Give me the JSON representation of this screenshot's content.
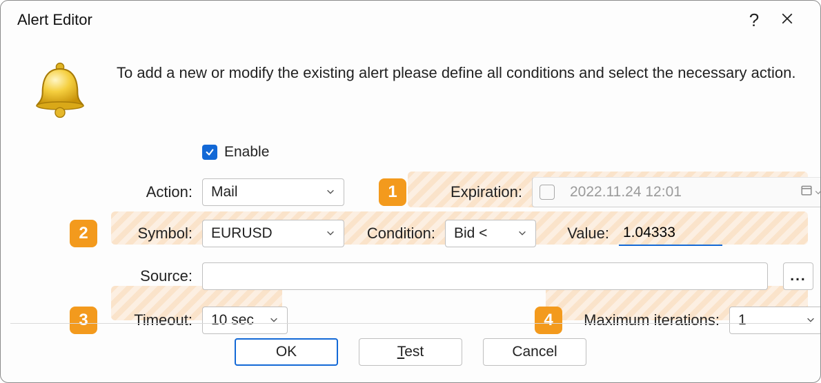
{
  "window": {
    "title": "Alert Editor"
  },
  "intro": "To add a new or modify the existing alert please define all conditions and select the necessary action.",
  "enable": {
    "label": "Enable",
    "checked": true
  },
  "labels": {
    "action": "Action:",
    "expiration": "Expiration:",
    "symbol": "Symbol:",
    "condition": "Condition:",
    "value": "Value:",
    "source": "Source:",
    "timeout": "Timeout:",
    "max_iterations": "Maximum iterations:"
  },
  "fields": {
    "action": "Mail",
    "symbol": "EURUSD",
    "condition": "Bid <",
    "value": "1.04333",
    "source": "",
    "timeout": "10 sec",
    "max_iterations": "1",
    "expiration": {
      "enabled": false,
      "value": "2022.11.24 12:01"
    }
  },
  "annotations": {
    "1": "1",
    "2": "2",
    "3": "3",
    "4": "4"
  },
  "buttons": {
    "ok": "OK",
    "test": "Test",
    "test_mnemonic": "T",
    "test_rest": "est",
    "cancel": "Cancel",
    "browse": "..."
  }
}
